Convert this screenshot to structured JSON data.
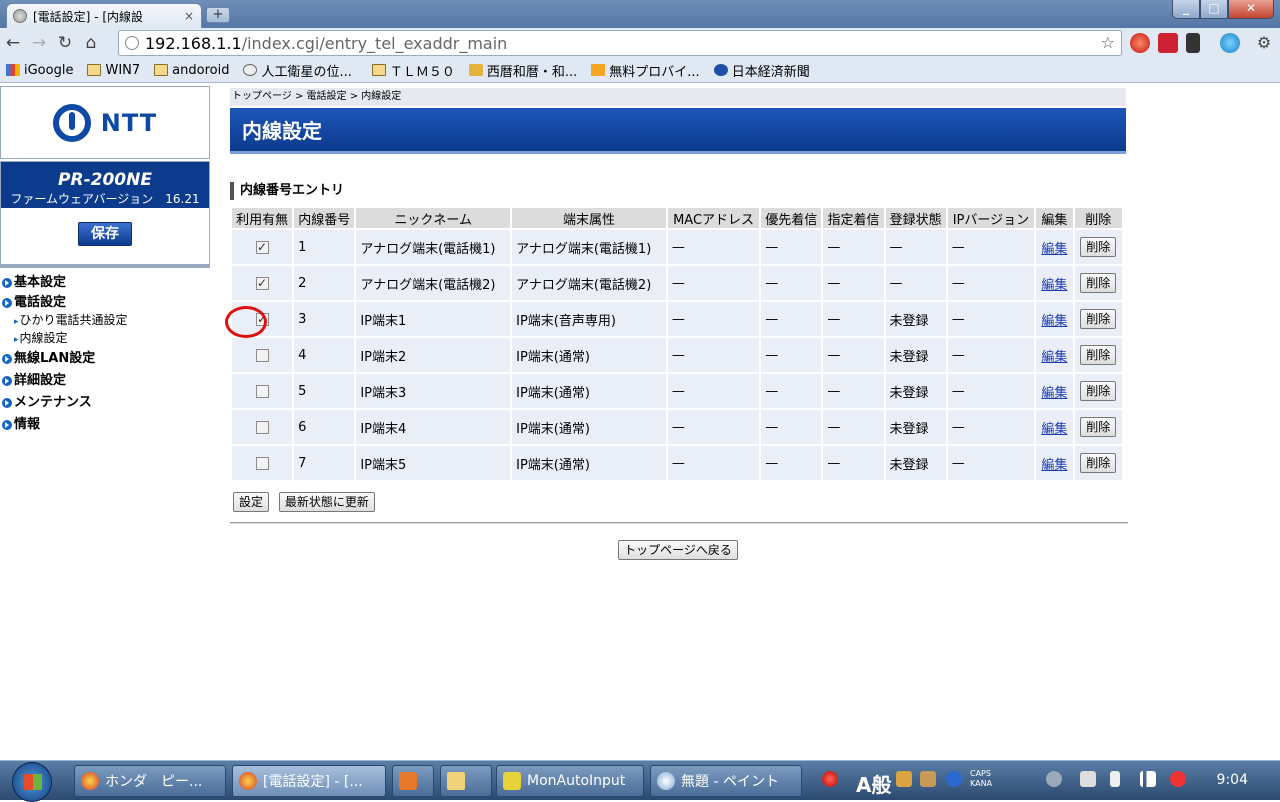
{
  "browser": {
    "tab_title": "[電話設定] - [内線設",
    "tab_close": "×",
    "new_tab": "+",
    "url_host": "192.168.1.1",
    "url_path": "/index.cgi/entry_tel_exaddr_main",
    "bookmarks": [
      "iGoogle",
      "WIN7",
      "andoroid",
      "人工衛星の位...",
      "ＴＬＭ５０",
      "西暦和暦・和...",
      "無料プロバイ...",
      "日本経済新聞"
    ],
    "window_buttons": {
      "minimize": "_",
      "maximize": "□",
      "close": "✕"
    }
  },
  "sidebar": {
    "logo": "NTT",
    "model": "PR-200NE",
    "firmware": "ファームウェアバージョン　16.21",
    "save": "保存",
    "nav": {
      "basic": "基本設定",
      "phone": "電話設定",
      "phone_sub1": "ひかり電話共通設定",
      "phone_sub2": "内線設定",
      "wlan": "無線LAN設定",
      "detail": "詳細設定",
      "maint": "メンテナンス",
      "info": "情報"
    }
  },
  "main": {
    "breadcrumb": "トップページ > 電話設定 > 内線設定",
    "title": "内線設定",
    "section": "内線番号エントリ",
    "headers": [
      "利用有無",
      "内線番号",
      "ニックネーム",
      "端末属性",
      "MACアドレス",
      "優先着信",
      "指定着信",
      "登録状態",
      "IPバージョン",
      "編集",
      "削除"
    ],
    "rows": [
      {
        "checked": true,
        "num": "1",
        "nick": "アナログ端末(電話機1)",
        "attr": "アナログ端末(電話機1)",
        "mac": "—",
        "prio": "—",
        "spec": "—",
        "reg": "—",
        "ipv": "—",
        "edit": "編集",
        "del": "削除"
      },
      {
        "checked": true,
        "num": "2",
        "nick": "アナログ端末(電話機2)",
        "attr": "アナログ端末(電話機2)",
        "mac": "—",
        "prio": "—",
        "spec": "—",
        "reg": "—",
        "ipv": "—",
        "edit": "編集",
        "del": "削除"
      },
      {
        "checked": true,
        "num": "3",
        "nick": "IP端末1",
        "attr": "IP端末(音声専用)",
        "mac": "—",
        "prio": "—",
        "spec": "—",
        "reg": "未登録",
        "ipv": "—",
        "edit": "編集",
        "del": "削除"
      },
      {
        "checked": false,
        "num": "4",
        "nick": "IP端末2",
        "attr": "IP端末(通常)",
        "mac": "—",
        "prio": "—",
        "spec": "—",
        "reg": "未登録",
        "ipv": "—",
        "edit": "編集",
        "del": "削除"
      },
      {
        "checked": false,
        "num": "5",
        "nick": "IP端末3",
        "attr": "IP端末(通常)",
        "mac": "—",
        "prio": "—",
        "spec": "—",
        "reg": "未登録",
        "ipv": "—",
        "edit": "編集",
        "del": "削除"
      },
      {
        "checked": false,
        "num": "6",
        "nick": "IP端末4",
        "attr": "IP端末(通常)",
        "mac": "—",
        "prio": "—",
        "spec": "—",
        "reg": "未登録",
        "ipv": "—",
        "edit": "編集",
        "del": "削除"
      },
      {
        "checked": false,
        "num": "7",
        "nick": "IP端末5",
        "attr": "IP端末(通常)",
        "mac": "—",
        "prio": "—",
        "spec": "—",
        "reg": "未登録",
        "ipv": "—",
        "edit": "編集",
        "del": "削除"
      }
    ],
    "btn_set": "設定",
    "btn_refresh": "最新状態に更新",
    "btn_back": "トップページへ戻る"
  },
  "taskbar": {
    "items": [
      "ホンダ　ピー...",
      "[電話設定] - [...",
      "",
      "",
      "MonAutoInput",
      "無題 - ペイント"
    ],
    "ime": "A般",
    "caps": "CAPS",
    "kana": "KANA",
    "clock": "9:04"
  },
  "colors": {
    "accent": "#0c3b8e",
    "highlight": "#e01010"
  }
}
